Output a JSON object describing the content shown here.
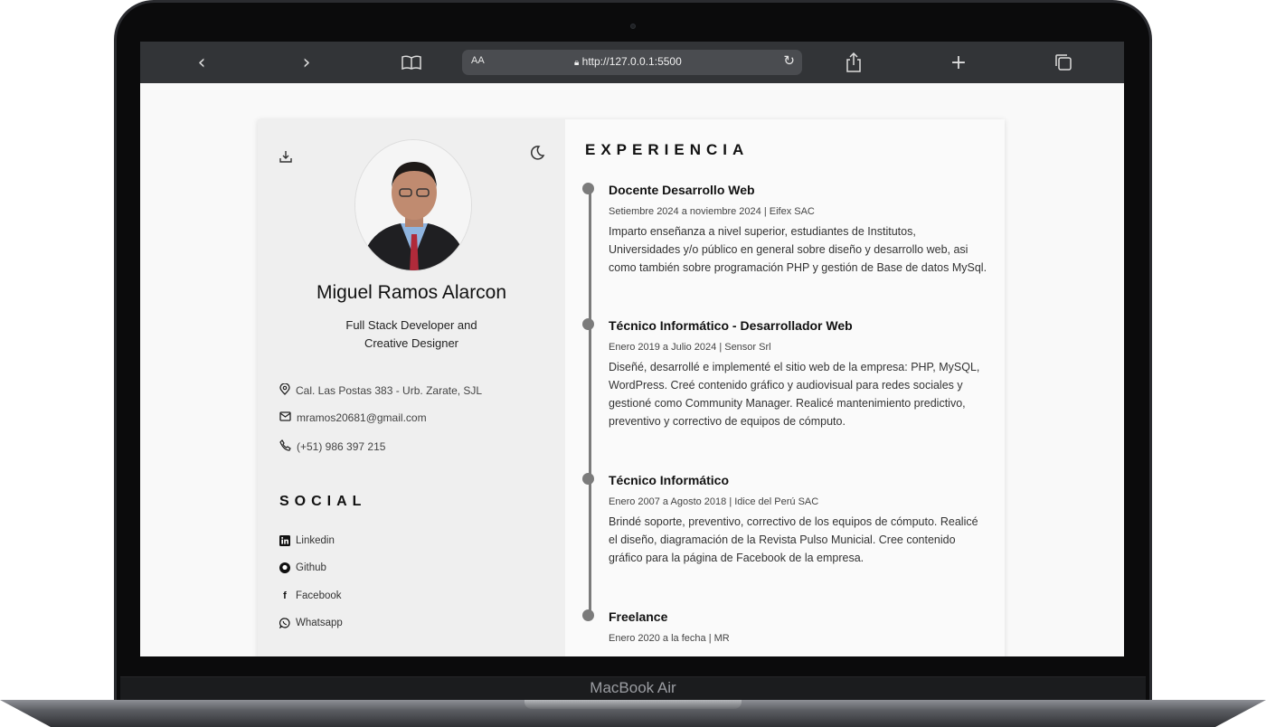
{
  "device": {
    "label": "MacBook Air"
  },
  "browser": {
    "aa_label": "AA",
    "url": "http://127.0.0.1:5500"
  },
  "profile": {
    "name": "Miguel Ramos Alarcon",
    "role_line1": "Full Stack Developer and",
    "role_line2": "Creative Designer",
    "address": "Cal. Las Postas 383 - Urb. Zarate, SJL",
    "email": "mramos20681@gmail.com",
    "phone": "(+51) 986 397 215"
  },
  "social": {
    "title": "SOCIAL",
    "links": [
      "Linkedin",
      "Github",
      "Facebook",
      "Whatsapp"
    ]
  },
  "experience": {
    "title": "EXPERIENCIA",
    "jobs": [
      {
        "title": "Docente Desarrollo Web",
        "meta": "Setiembre 2024 a noviembre 2024 | Eifex SAC",
        "desc": "Imparto enseñanza a nivel superior, estudiantes de Institutos, Universidades y/o público en general sobre diseño y desarrollo web, asi como también sobre programación PHP y gestión de Base de datos MySql."
      },
      {
        "title": "Técnico Informático - Desarrollador Web",
        "meta": "Enero 2019 a Julio 2024 | Sensor Srl",
        "desc": "Diseñé, desarrollé e implementé el sitio web de la empresa: PHP, MySQL, WordPress. Creé contenido gráfico y audiovisual para redes sociales y gestioné como Community Manager. Realicé mantenimiento predictivo, preventivo y correctivo de equipos de cómputo."
      },
      {
        "title": "Técnico Informático",
        "meta": "Enero 2007 a Agosto 2018 | Idice del Perú SAC",
        "desc": "Brindé soporte, preventivo, correctivo de los equipos de cómputo. Realicé el diseño, diagramación de la Revista Pulso Municial. Cree contenido gráfico para la página de Facebook de la empresa."
      },
      {
        "title": "Freelance",
        "meta": "Enero 2020 a la fecha | MR",
        "desc": ""
      }
    ]
  }
}
